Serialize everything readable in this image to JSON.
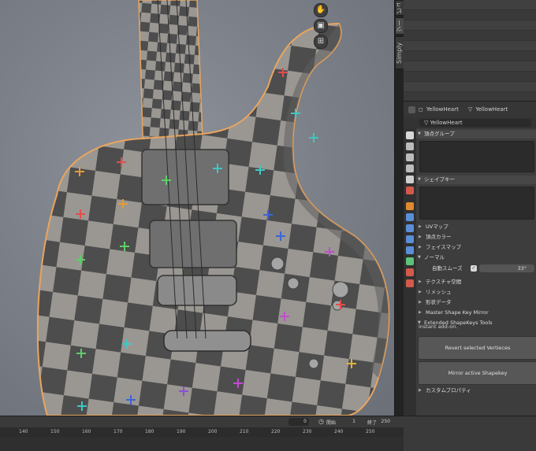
{
  "viewport": {
    "tools": [
      {
        "icon": "hand-icon",
        "glyph": "✋"
      },
      {
        "icon": "camera-icon",
        "glyph": "▣"
      },
      {
        "icon": "grid-icon",
        "glyph": "⊞"
      }
    ]
  },
  "side_tabs": [
    "ビュー",
    "ツール",
    "Simply Cloth"
  ],
  "properties": {
    "object_name": "YellowHeart",
    "mesh_name": "YellowHeart",
    "mesh_data_name": "YellowHeart",
    "panels": {
      "vertex_groups": "頂点グループ",
      "shape_keys": "シェイプキー",
      "uv_maps": "UVマップ",
      "vertex_colors": "頂点カラー",
      "face_maps": "フェイスマップ",
      "normals": "ノーマル",
      "texture_space": "テクスチャ空間",
      "remesh": "リメッシュ",
      "geometry_data": "形状データ",
      "master_shape_key_mirror": "Master Shape Key Mirror",
      "extended_shapekeys_tools": "Extended ShapeKeys Tools",
      "custom_properties": "カスタムプロパティ"
    },
    "auto_smooth": {
      "label": "自動スムーズ",
      "checked": true,
      "angle": "33°"
    },
    "addon_note": "instant add-on.",
    "buttons": {
      "revert": "Revert selected Vertieces",
      "mirror": "Mirror active Shapekey"
    }
  },
  "timeline": {
    "current_frame": "0",
    "start_label": "開始",
    "start": "1",
    "end_label": "終了",
    "end": "250",
    "ticks": [
      "140",
      "150",
      "160",
      "170",
      "180",
      "190",
      "200",
      "210",
      "220",
      "230",
      "240",
      "250"
    ]
  },
  "accent_colors": {
    "selection_outline": "#e8a050",
    "active_tab": "#5a5a5a"
  }
}
